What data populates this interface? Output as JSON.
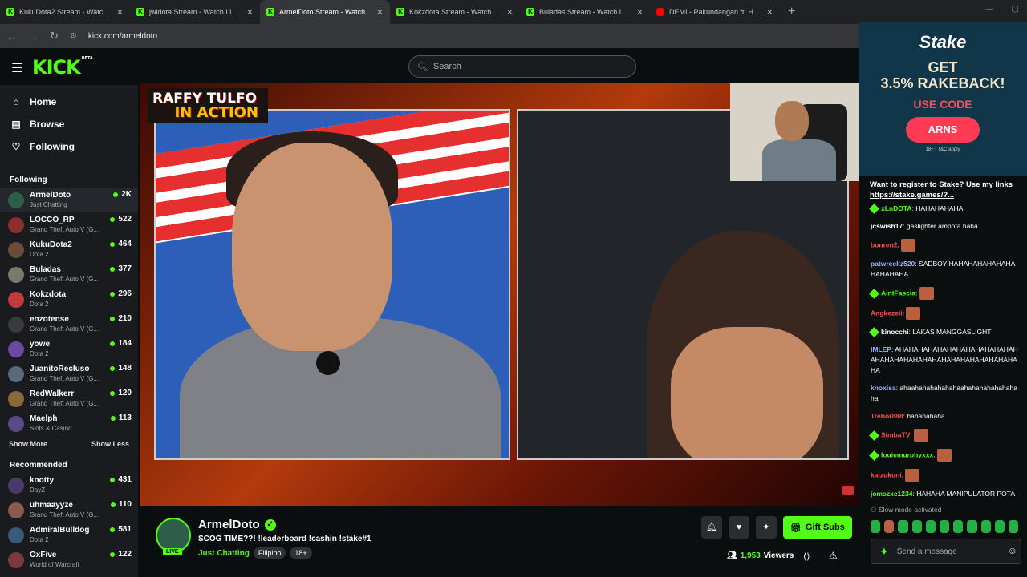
{
  "browser": {
    "tabs": [
      {
        "title": "KukuDota2 Stream - Watch Live",
        "icon": "kick-favicon",
        "active": false
      },
      {
        "title": "jwldota Stream - Watch Live on",
        "icon": "kick-favicon",
        "active": false
      },
      {
        "title": "ArmelDoto Stream - Watch",
        "icon": "kick-favicon",
        "active": true
      },
      {
        "title": "Kokzdota Stream - Watch Live",
        "icon": "kick-favicon",
        "active": false
      },
      {
        "title": "Buladas Stream - Watch Live on",
        "icon": "kick-favicon",
        "active": false
      },
      {
        "title": "DEMI - Pakundangan ft. Hev Ab",
        "icon": "youtube-favicon",
        "active": false
      }
    ],
    "url": "kick.com/armeldoto"
  },
  "header": {
    "logo": "KICK",
    "beta": "BETA",
    "search_placeholder": "Search"
  },
  "sidebar": {
    "nav": [
      {
        "label": "Home",
        "icon": "home-icon"
      },
      {
        "label": "Browse",
        "icon": "browse-icon"
      },
      {
        "label": "Following",
        "icon": "heart-icon"
      }
    ],
    "following_title": "Following",
    "following": [
      {
        "name": "ArmelDoto",
        "game": "Just Chatting",
        "viewers": "2K",
        "color": "#2e5e4a"
      },
      {
        "name": "LOCCO_RP",
        "game": "Grand Theft Auto V (G...",
        "viewers": "522",
        "color": "#8a2e2e"
      },
      {
        "name": "KukuDota2",
        "game": "Dota 2",
        "viewers": "464",
        "color": "#6b4a3a"
      },
      {
        "name": "Buladas",
        "game": "Grand Theft Auto V (G...",
        "viewers": "377",
        "color": "#7a7a6a"
      },
      {
        "name": "Kokzdota",
        "game": "Dota 2",
        "viewers": "296",
        "color": "#c23a3a"
      },
      {
        "name": "enzotense",
        "game": "Grand Theft Auto V (G...",
        "viewers": "210",
        "color": "#3a3a3a"
      },
      {
        "name": "yowe",
        "game": "Dota 2",
        "viewers": "184",
        "color": "#6a4aa0"
      },
      {
        "name": "JuanitoRecluso",
        "game": "Grand Theft Auto V (G...",
        "viewers": "148",
        "color": "#5a6a7a"
      },
      {
        "name": "RedWalkerr",
        "game": "Grand Theft Auto V (G...",
        "viewers": "120",
        "color": "#8a6a3a"
      },
      {
        "name": "Maelph",
        "game": "Slots & Casino",
        "viewers": "113",
        "color": "#5a4a8a"
      }
    ],
    "show_more": "Show More",
    "show_less": "Show Less",
    "recommended_title": "Recommended",
    "recommended": [
      {
        "name": "knotty",
        "game": "DayZ",
        "viewers": "431",
        "color": "#4a3a6a"
      },
      {
        "name": "uhmaayyze",
        "game": "Grand Theft Auto V (G...",
        "viewers": "110",
        "color": "#8a5a4a"
      },
      {
        "name": "AdmiralBulldog",
        "game": "Dota 2",
        "viewers": "581",
        "color": "#3a5a7a"
      },
      {
        "name": "OxFive",
        "game": "World of Warcraft",
        "viewers": "122",
        "color": "#7a3a3a"
      }
    ]
  },
  "video": {
    "overlay_line1": "RAFFY TULFO",
    "overlay_line2": "IN ACTION"
  },
  "ad": {
    "brand": "Stake",
    "line1": "GET",
    "line2": "3.5% RAKEBACK!",
    "line3": "USE CODE",
    "code": "ARNS",
    "terms": "18+ | T&C apply"
  },
  "chat": {
    "pinned_text": "Want to register to Stake? Use my links",
    "pinned_link": "https://stake.games/?...",
    "messages": [
      {
        "user": "xLnDOTA",
        "text": "HAHAHAHAHA",
        "color": "#53fc18",
        "badge": true,
        "emote": false
      },
      {
        "user": "jcswish17",
        "text": "gaslighter ampota haha",
        "color": "#ffffff",
        "badge": false,
        "emote": false
      },
      {
        "user": "bonren2",
        "text": "",
        "color": "#ff4d4d",
        "badge": false,
        "emote": true
      },
      {
        "user": "patwreckz520",
        "text": "SADBOY HAHAHAHAHAHAHAHAHAHAHA",
        "color": "#9ab3ff",
        "badge": false,
        "emote": false
      },
      {
        "user": "AintFascia",
        "text": "",
        "color": "#53fc18",
        "badge": true,
        "emote": true
      },
      {
        "user": "Angkezeii",
        "text": "",
        "color": "#ff4d4d",
        "badge": false,
        "emote": true
      },
      {
        "user": "kinocchi",
        "text": "LAKAS MANGGASLIGHT",
        "color": "#ffffff",
        "badge": true,
        "emote": false
      },
      {
        "user": "IMLEP",
        "text": "AHAHAHAHAHAHAHAHAHAHAHAHAHAHAHAHAHAHAHAHAHAHAHAHAHAHAHAHAHA",
        "color": "#9ab3ff",
        "badge": false,
        "emote": false
      },
      {
        "user": "knoxisa",
        "text": "ahaahahahahahahaahahahahahahahaha",
        "color": "#9ab3ff",
        "badge": false,
        "emote": false
      },
      {
        "user": "Trebor888",
        "text": "hahahahaha",
        "color": "#ff4d4d",
        "badge": false,
        "emote": false
      },
      {
        "user": "SimbaTV",
        "text": "",
        "color": "#ff4d4d",
        "badge": true,
        "emote": true
      },
      {
        "user": "louiemurphyxxx",
        "text": "",
        "color": "#53fc18",
        "badge": true,
        "emote": true
      },
      {
        "user": "kaizukuni",
        "text": "",
        "color": "#ff4d4d",
        "badge": false,
        "emote": true
      },
      {
        "user": "jomszxc1234",
        "text": "HAHAHA MANIPULATOR POTA",
        "color": "#53fc18",
        "badge": false,
        "emote": false
      }
    ],
    "slow_mode": "Slow mode activated",
    "send_placeholder": "Send a message"
  },
  "channel": {
    "name": "ArmelDoto",
    "title": "SCOG TIME??! !leaderboard !cashin !stake#1",
    "category": "Just Chatting",
    "tags": [
      "Filipino",
      "18+"
    ],
    "live_label": "LIVE",
    "gift_label": "Gift Subs",
    "viewers": "1,953",
    "viewers_label": "Viewers"
  },
  "colors": {
    "accent": "#53fc18",
    "bg": "#0b0e0f",
    "sidebar": "#191b1f"
  }
}
